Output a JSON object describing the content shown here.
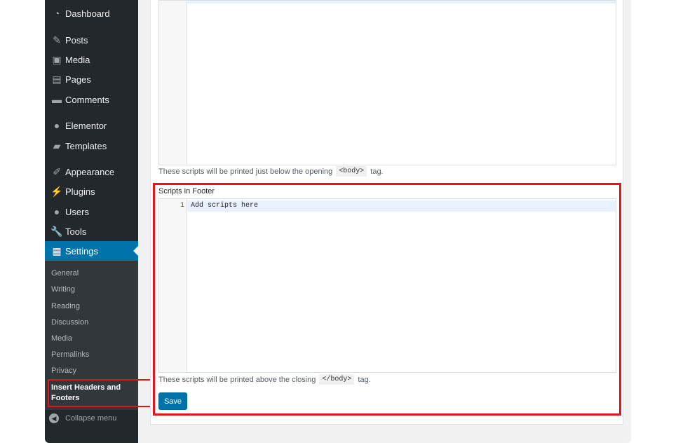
{
  "sidebar": {
    "items": [
      {
        "label": "Dashboard",
        "icon": "dashboard-icon"
      },
      {
        "label": "Posts",
        "icon": "pin-icon"
      },
      {
        "label": "Media",
        "icon": "media-icon"
      },
      {
        "label": "Pages",
        "icon": "pages-icon"
      },
      {
        "label": "Comments",
        "icon": "comment-icon"
      },
      {
        "label": "Elementor",
        "icon": "elementor-icon"
      },
      {
        "label": "Templates",
        "icon": "folder-icon"
      },
      {
        "label": "Appearance",
        "icon": "brush-icon"
      },
      {
        "label": "Plugins",
        "icon": "plug-icon"
      },
      {
        "label": "Users",
        "icon": "user-icon"
      },
      {
        "label": "Tools",
        "icon": "wrench-icon"
      },
      {
        "label": "Settings",
        "icon": "settings-icon"
      }
    ],
    "submenu": [
      "General",
      "Writing",
      "Reading",
      "Discussion",
      "Media",
      "Permalinks",
      "Privacy"
    ],
    "current_submenu": "Insert Headers and Footers",
    "collapse_label": "Collapse menu"
  },
  "body_section": {
    "description_before": "These scripts will be printed just below the opening",
    "tag": "<body>",
    "description_after": "tag."
  },
  "footer_section": {
    "title": "Scripts in Footer",
    "line_number": "1",
    "line_text": "Add scripts here",
    "description_before": "These scripts will be printed above the closing",
    "tag": "</body>",
    "description_after": "tag."
  },
  "save_label": "Save",
  "colors": {
    "sidebar_bg": "#23282d",
    "active_blue": "#0073aa",
    "highlight_red": "#e4141c"
  }
}
